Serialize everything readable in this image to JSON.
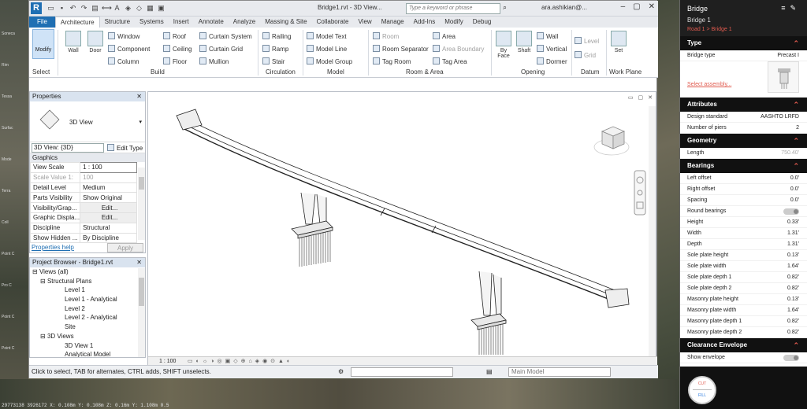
{
  "desktop": {
    "left_labels": [
      "Soneca",
      "Rim",
      "Tessa",
      "Surfac",
      "Mode",
      "Terra",
      "Coll",
      "Point C",
      "Pro C",
      "Point C",
      "Point C"
    ],
    "coordinates": "29773138 3926172 X: 0.108m Y: 0.108m Z: 0.16m Y: 1.108m 0.5"
  },
  "revit": {
    "title": "Bridge1.rvt - 3D View...",
    "search_placeholder": "Type a keyword or phrase",
    "user": "ara.ashikian@...",
    "tabs": [
      "File",
      "Architecture",
      "Structure",
      "Systems",
      "Insert",
      "Annotate",
      "Analyze",
      "Massing & Site",
      "Collaborate",
      "View",
      "Manage",
      "Add-Ins",
      "Modify",
      "Debug"
    ],
    "active_tab": "Architecture",
    "ribbon": {
      "modify": "Modify",
      "select": "Select",
      "wall": "Wall",
      "door": "Door",
      "window": "Window",
      "component": "Component",
      "column": "Column",
      "roof": "Roof",
      "ceiling": "Ceiling",
      "floor": "Floor",
      "curtain_system": "Curtain System",
      "curtain_grid": "Curtain Grid",
      "mullion": "Mullion",
      "railing": "Railing",
      "ramp": "Ramp",
      "stair": "Stair",
      "model_text": "Model Text",
      "model_line": "Model Line",
      "model_group": "Model Group",
      "room": "Room",
      "room_separator": "Room Separator",
      "tag_room": "Tag Room",
      "area": "Area",
      "area_boundary": "Area Boundary",
      "tag_area": "Tag Area",
      "by_face": "By Face",
      "shaft": "Shaft",
      "wall_open": "Wall",
      "vertical": "Vertical",
      "dormer": "Dormer",
      "level": "Level",
      "grid": "Grid",
      "set": "Set",
      "groups": {
        "build": "Build",
        "circulation": "Circulation",
        "model": "Model",
        "room_area": "Room & Area",
        "opening": "Opening",
        "datum": "Datum",
        "work_plane": "Work Plane"
      }
    },
    "properties": {
      "title": "Properties",
      "type_name": "3D View",
      "view_selector": "3D View: {3D}",
      "edit_type": "Edit Type",
      "group": "Graphics",
      "rows": [
        {
          "k": "View Scale",
          "v": "1 : 100"
        },
        {
          "k": "Scale Value    1:",
          "v": "100"
        },
        {
          "k": "Detail Level",
          "v": "Medium"
        },
        {
          "k": "Parts Visibility",
          "v": "Show Original"
        },
        {
          "k": "Visibility/Grap...",
          "v": "Edit..."
        },
        {
          "k": "Graphic Displa...",
          "v": "Edit..."
        },
        {
          "k": "Discipline",
          "v": "Structural"
        },
        {
          "k": "Show Hidden ...",
          "v": "By Discipline"
        }
      ],
      "help": "Properties help",
      "apply": "Apply"
    },
    "browser": {
      "title": "Project Browser - Bridge1.rvt",
      "items": [
        "Views (all)",
        "Structural Plans",
        "Level 1",
        "Level 1 - Analytical",
        "Level 2",
        "Level 2 - Analytical",
        "Site",
        "3D Views",
        "3D View 1",
        "Analytical Model"
      ]
    },
    "viewport": {
      "scale": "1 : 100"
    },
    "status": {
      "message": "Click to select, TAB for alternates, CTRL adds, SHIFT unselects.",
      "model": "Main Model"
    }
  },
  "panel": {
    "title": "Bridge",
    "subtitle": "Bridge 1",
    "crumb1": "Road 1",
    "crumb_sep": ">",
    "crumb2": "Bridge 1",
    "type_section": "Type",
    "bridge_type_label": "Bridge type",
    "bridge_type_value": "Precast I",
    "select_assembly": "Select assembly...",
    "attributes_section": "Attributes",
    "design_standard_label": "Design standard",
    "design_standard_value": "AASHTO LRFD",
    "piers_label": "Number of piers",
    "piers_value": "2",
    "geometry_section": "Geometry",
    "length_label": "Length",
    "length_value": "750.40'",
    "bearings_section": "Bearings",
    "bearing_rows": [
      {
        "k": "Left offset",
        "v": "0.0'"
      },
      {
        "k": "Right offset",
        "v": "0.0'"
      },
      {
        "k": "Spacing",
        "v": "0.0'"
      },
      {
        "k": "Round bearings",
        "v": ""
      },
      {
        "k": "Height",
        "v": "0.33'"
      },
      {
        "k": "Width",
        "v": "1.31'"
      },
      {
        "k": "Depth",
        "v": "1.31'"
      },
      {
        "k": "Sole plate height",
        "v": "0.13'"
      },
      {
        "k": "Sole plate width",
        "v": "1.64'"
      },
      {
        "k": "Sole plate depth 1",
        "v": "0.82'"
      },
      {
        "k": "Sole plate depth 2",
        "v": "0.82'"
      },
      {
        "k": "Masonry plate height",
        "v": "0.13'"
      },
      {
        "k": "Masonry plate width",
        "v": "1.64'"
      },
      {
        "k": "Masonry plate depth 1",
        "v": "0.82'"
      },
      {
        "k": "Masonry plate depth 2",
        "v": "0.82'"
      }
    ],
    "clearance_section": "Clearance Envelope",
    "show_envelope_label": "Show envelope",
    "cut": "CUT",
    "fill": "FILL"
  }
}
